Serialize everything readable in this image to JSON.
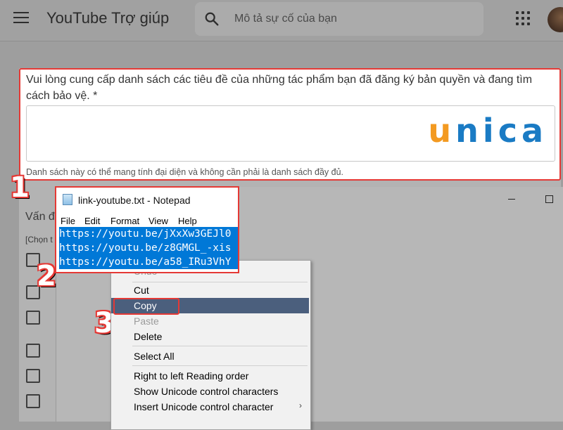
{
  "header": {
    "title": "YouTube Trợ giúp",
    "search_placeholder": "Mô tả sự cố của bạn"
  },
  "question": {
    "text": "Vui lòng cung cấp danh sách các tiêu đề của những tác phẩm bạn đã đăng ký bản quyền và đang tìm cách bảo vệ. *",
    "hint": "Danh sách này có thể mang tính đại diện và không cần phải là danh sách đầy đủ.",
    "logo_text": "unica",
    "logo_colors": {
      "u": "#f39a21",
      "rest": "#1a7bc4"
    }
  },
  "background_form": {
    "section_label": "Vấn đ",
    "section_hint": "[Chọn t"
  },
  "steps": [
    "1",
    "2",
    "3"
  ],
  "notepad": {
    "title": "link-youtube.txt - Notepad",
    "menu": [
      {
        "label": "File",
        "accel": "F"
      },
      {
        "label": "Edit",
        "accel": "E"
      },
      {
        "label": "Format",
        "accel": "o"
      },
      {
        "label": "View",
        "accel": "V"
      },
      {
        "label": "Help",
        "accel": "H"
      }
    ],
    "lines": [
      "https://youtu.be/jXxXw3GEJl0",
      "https://youtu.be/z8GMGL_-xis",
      "https://youtu.be/a58_IRu3VhY"
    ],
    "selection_color": "#0078d7"
  },
  "context_menu": {
    "items": [
      {
        "label": "Undo",
        "disabled": true
      },
      {
        "label": "Cut",
        "disabled": false
      },
      {
        "label": "Copy",
        "disabled": false,
        "highlighted": true
      },
      {
        "label": "Paste",
        "disabled": true
      },
      {
        "label": "Delete",
        "disabled": false
      },
      {
        "label": "Select All",
        "disabled": false
      },
      {
        "label": "Right to left Reading order",
        "disabled": false
      },
      {
        "label": "Show Unicode control characters",
        "disabled": false
      },
      {
        "label": "Insert Unicode control character",
        "disabled": false,
        "submenu": true
      }
    ]
  },
  "colors": {
    "annotation_red": "#e53935",
    "menu_highlight": "#4b5f7d"
  }
}
